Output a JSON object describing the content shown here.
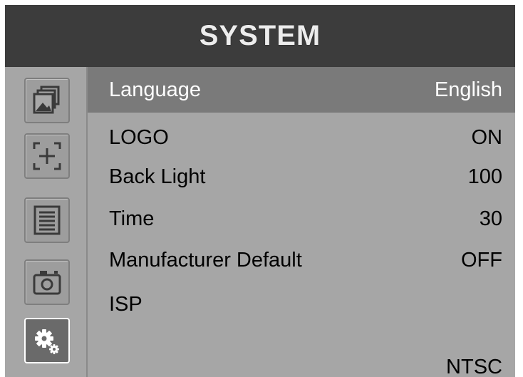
{
  "header": {
    "title": "SYSTEM"
  },
  "sidebar": {
    "tabs": [
      {
        "icon": "picture-icon",
        "active": false
      },
      {
        "icon": "marker-icon",
        "active": false
      },
      {
        "icon": "function-list-icon",
        "active": false
      },
      {
        "icon": "camera-icon",
        "active": false
      },
      {
        "icon": "system-gears-icon",
        "active": true
      }
    ]
  },
  "menu": {
    "items": [
      {
        "label": "Language",
        "value": "English",
        "selected": true
      },
      {
        "label": "LOGO",
        "value": "ON",
        "selected": false
      },
      {
        "label": "Back Light",
        "value": "100",
        "selected": false
      },
      {
        "label": "Time",
        "value": "30",
        "selected": false
      },
      {
        "label": "Manufacturer Default",
        "value": "OFF",
        "selected": false
      },
      {
        "label": "ISP",
        "value": "",
        "selected": false
      },
      {
        "label": "",
        "value": "NTSC",
        "selected": false
      }
    ]
  },
  "colors": {
    "header_bg": "#3c3c3c",
    "panel_bg": "#a6a6a6",
    "selection_bg": "#7a7a7a",
    "active_tab_bg": "#6a6a6a"
  }
}
